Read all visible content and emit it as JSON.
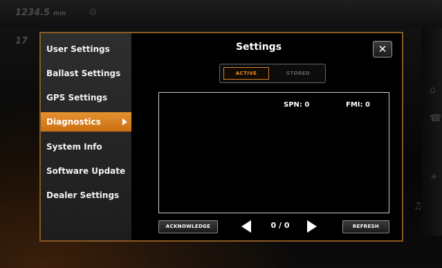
{
  "background": {
    "readout_top": "1234.5",
    "readout_top_unit": "mm",
    "readout_second": "17"
  },
  "sidebar": {
    "items": [
      {
        "label": "User Settings"
      },
      {
        "label": "Ballast Settings"
      },
      {
        "label": "GPS Settings"
      },
      {
        "label": "Diagnostics",
        "active": true
      },
      {
        "label": "System Info"
      },
      {
        "label": "Software Update"
      },
      {
        "label": "Dealer Settings"
      }
    ]
  },
  "dialog": {
    "title": "Settings",
    "close_glyph": "✕"
  },
  "toggle": {
    "active_label": "ACTIVE",
    "stored_label": "STORED",
    "selected": "ACTIVE"
  },
  "diagnostics": {
    "spn_label": "SPN:",
    "spn_value": "0",
    "fmi_label": "FMI:",
    "fmi_value": "0"
  },
  "pager": {
    "current": "0",
    "separator": "/",
    "total": "0"
  },
  "buttons": {
    "acknowledge": "ACKNOWLEDGE",
    "refresh": "REFRESH"
  },
  "colors": {
    "accent": "#e6922e",
    "border": "#8a5a22"
  },
  "icons": [
    "gear-icon",
    "home-icon",
    "phone-icon",
    "music-icon",
    "light-icon",
    "close-icon",
    "arrow-left-icon",
    "arrow-right-icon"
  ]
}
